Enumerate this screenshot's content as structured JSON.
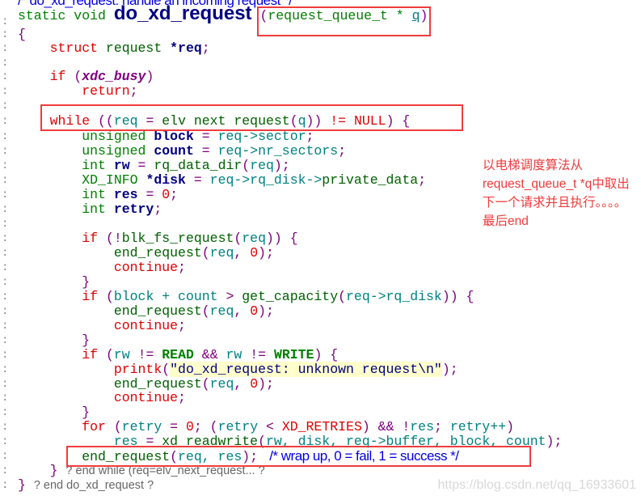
{
  "code_lines": [
    [
      [
        "/* do_xd_request: handle an incoming request */",
        "cm"
      ]
    ],
    [
      [
        "static void ",
        "ty"
      ],
      [
        "do_xd_request",
        "title"
      ],
      [
        " (",
        "p"
      ],
      [
        "request_queue_t * ",
        "ty"
      ],
      [
        "q",
        "lv ul"
      ],
      [
        ")",
        "p"
      ]
    ],
    [
      [
        "{",
        "p"
      ]
    ],
    [
      [
        "    "
      ],
      [
        "struct ",
        "kw"
      ],
      [
        "request ",
        "fn"
      ],
      [
        "*req",
        "var"
      ],
      [
        ";",
        "p"
      ]
    ],
    [],
    [
      [
        "    "
      ],
      [
        "if ",
        "kw"
      ],
      [
        "(",
        "p"
      ],
      [
        "xdc_busy",
        "it"
      ],
      [
        ")",
        "p"
      ]
    ],
    [
      [
        "        "
      ],
      [
        "return",
        "kw"
      ],
      [
        ";",
        "p"
      ]
    ],
    [],
    [
      [
        "    "
      ],
      [
        "while ",
        "kw"
      ],
      [
        "((",
        "p"
      ],
      [
        "req ",
        "lv"
      ],
      [
        "= ",
        "p"
      ],
      [
        "elv next request",
        "fn"
      ],
      [
        "(",
        "p"
      ],
      [
        "q",
        "lv"
      ],
      [
        ")) ",
        "p"
      ],
      [
        "!= ",
        "mc"
      ],
      [
        "NULL",
        "mc"
      ],
      [
        ") {",
        "p"
      ]
    ],
    [
      [
        "        "
      ],
      [
        "unsigned ",
        "ty"
      ],
      [
        "block",
        "var"
      ],
      [
        " = ",
        "p"
      ],
      [
        "req->sector",
        "lv"
      ],
      [
        ";",
        "p"
      ]
    ],
    [
      [
        "        "
      ],
      [
        "unsigned ",
        "ty"
      ],
      [
        "count",
        "var"
      ],
      [
        " = ",
        "p"
      ],
      [
        "req->nr_sectors",
        "lv"
      ],
      [
        ";",
        "p"
      ]
    ],
    [
      [
        "        "
      ],
      [
        "int ",
        "ty"
      ],
      [
        "rw",
        "var"
      ],
      [
        " = ",
        "p"
      ],
      [
        "rq_data_dir",
        "fn"
      ],
      [
        "(",
        "p"
      ],
      [
        "req",
        "lv"
      ],
      [
        ");",
        "p"
      ]
    ],
    [
      [
        "        "
      ],
      [
        "XD_INFO ",
        "ty"
      ],
      [
        "*disk",
        "var"
      ],
      [
        " = ",
        "p"
      ],
      [
        "req->rq_disk->",
        "lv"
      ],
      [
        "private_data",
        "fn"
      ],
      [
        ";",
        "p"
      ]
    ],
    [
      [
        "        "
      ],
      [
        "int ",
        "ty"
      ],
      [
        "res",
        "var"
      ],
      [
        " = ",
        "p"
      ],
      [
        "0",
        "num"
      ],
      [
        ";",
        "p"
      ]
    ],
    [
      [
        "        "
      ],
      [
        "int ",
        "ty"
      ],
      [
        "retry",
        "var"
      ],
      [
        ";",
        "p"
      ]
    ],
    [],
    [
      [
        "        "
      ],
      [
        "if ",
        "kw"
      ],
      [
        "(!",
        "p"
      ],
      [
        "blk_fs_request",
        "fn"
      ],
      [
        "(",
        "p"
      ],
      [
        "req",
        "lv"
      ],
      [
        ")) {",
        "p"
      ]
    ],
    [
      [
        "            "
      ],
      [
        "end_request",
        "fn"
      ],
      [
        "(",
        "p"
      ],
      [
        "req",
        "lv"
      ],
      [
        ", ",
        "p"
      ],
      [
        "0",
        "num"
      ],
      [
        ");",
        "p"
      ]
    ],
    [
      [
        "            "
      ],
      [
        "continue",
        "kw"
      ],
      [
        ";",
        "p"
      ]
    ],
    [
      [
        "        "
      ],
      [
        "}",
        "p"
      ]
    ],
    [
      [
        "        "
      ],
      [
        "if ",
        "kw"
      ],
      [
        "(",
        "p"
      ],
      [
        "block + count ",
        "lv"
      ],
      [
        "> ",
        "p"
      ],
      [
        "get_capacity",
        "fn"
      ],
      [
        "(",
        "p"
      ],
      [
        "req->rq_disk",
        "lv"
      ],
      [
        ")) {",
        "p"
      ]
    ],
    [
      [
        "            "
      ],
      [
        "end_request",
        "fn"
      ],
      [
        "(",
        "p"
      ],
      [
        "req",
        "lv"
      ],
      [
        ", ",
        "p"
      ],
      [
        "0",
        "num"
      ],
      [
        ");",
        "p"
      ]
    ],
    [
      [
        "            "
      ],
      [
        "continue",
        "kw"
      ],
      [
        ";",
        "p"
      ]
    ],
    [
      [
        "        "
      ],
      [
        "}",
        "p"
      ]
    ],
    [
      [
        "        "
      ],
      [
        "if ",
        "kw"
      ],
      [
        "(",
        "p"
      ],
      [
        "rw ",
        "lv"
      ],
      [
        "!= ",
        "p"
      ],
      [
        "READ",
        "mg"
      ],
      [
        " && ",
        "p"
      ],
      [
        "rw ",
        "lv"
      ],
      [
        "!= ",
        "p"
      ],
      [
        "WRITE",
        "mg"
      ],
      [
        ") {",
        "p"
      ]
    ],
    [
      [
        "            "
      ],
      [
        "printk",
        "kw"
      ],
      [
        "(",
        "p"
      ],
      [
        "\"do_xd_request: unknown request\\n\"",
        "str"
      ],
      [
        ");",
        "p"
      ]
    ],
    [
      [
        "            "
      ],
      [
        "end_request",
        "fn"
      ],
      [
        "(",
        "p"
      ],
      [
        "req",
        "lv"
      ],
      [
        ", ",
        "p"
      ],
      [
        "0",
        "num"
      ],
      [
        ");",
        "p"
      ]
    ],
    [
      [
        "            "
      ],
      [
        "continue",
        "kw"
      ],
      [
        ";",
        "p"
      ]
    ],
    [
      [
        "        "
      ],
      [
        "}",
        "p"
      ]
    ],
    [
      [
        "        "
      ],
      [
        "for ",
        "kw"
      ],
      [
        "(",
        "p"
      ],
      [
        "retry ",
        "lv"
      ],
      [
        "= ",
        "p"
      ],
      [
        "0",
        "num"
      ],
      [
        "; (",
        "p"
      ],
      [
        "retry ",
        "lv"
      ],
      [
        "< ",
        "p"
      ],
      [
        "XD_RETRIES",
        "mc"
      ],
      [
        ") && !",
        "p"
      ],
      [
        "res",
        "lv"
      ],
      [
        "; ",
        "p"
      ],
      [
        "retry++",
        "lv"
      ],
      [
        ")",
        "p"
      ]
    ],
    [
      [
        "            "
      ],
      [
        "res ",
        "lv"
      ],
      [
        "= ",
        "p"
      ],
      [
        "xd_readwrite",
        "fn"
      ],
      [
        "(",
        "p"
      ],
      [
        "rw, disk, req->buffer, block, count",
        "lv"
      ],
      [
        ");",
        "p"
      ]
    ],
    [
      [
        "        "
      ],
      [
        "end_request",
        "fn"
      ],
      [
        "(",
        "p"
      ],
      [
        "req, res",
        "lv"
      ],
      [
        "); ",
        "p"
      ],
      [
        " /* wrap up, 0 = fail, 1 = success */",
        "cm"
      ]
    ],
    [
      [
        "    "
      ],
      [
        "} ",
        "p"
      ],
      [
        "? end while (req=elv_next_request... ?",
        "gm"
      ]
    ],
    [
      [
        "} ",
        "p"
      ],
      [
        "? end do_xd_request ?",
        "gm"
      ]
    ]
  ],
  "annotation": "以电梯调度算法从request_queue_t *q中取出下一个请求并且执行。。。。最后end",
  "watermark": "https://blog.csdn.net/qq_16933601",
  "line_marker": ":",
  "colors": {
    "keyword": "#e00000",
    "type": "#008000",
    "variable": "#000080",
    "highlight_box": "#f03c3c"
  }
}
